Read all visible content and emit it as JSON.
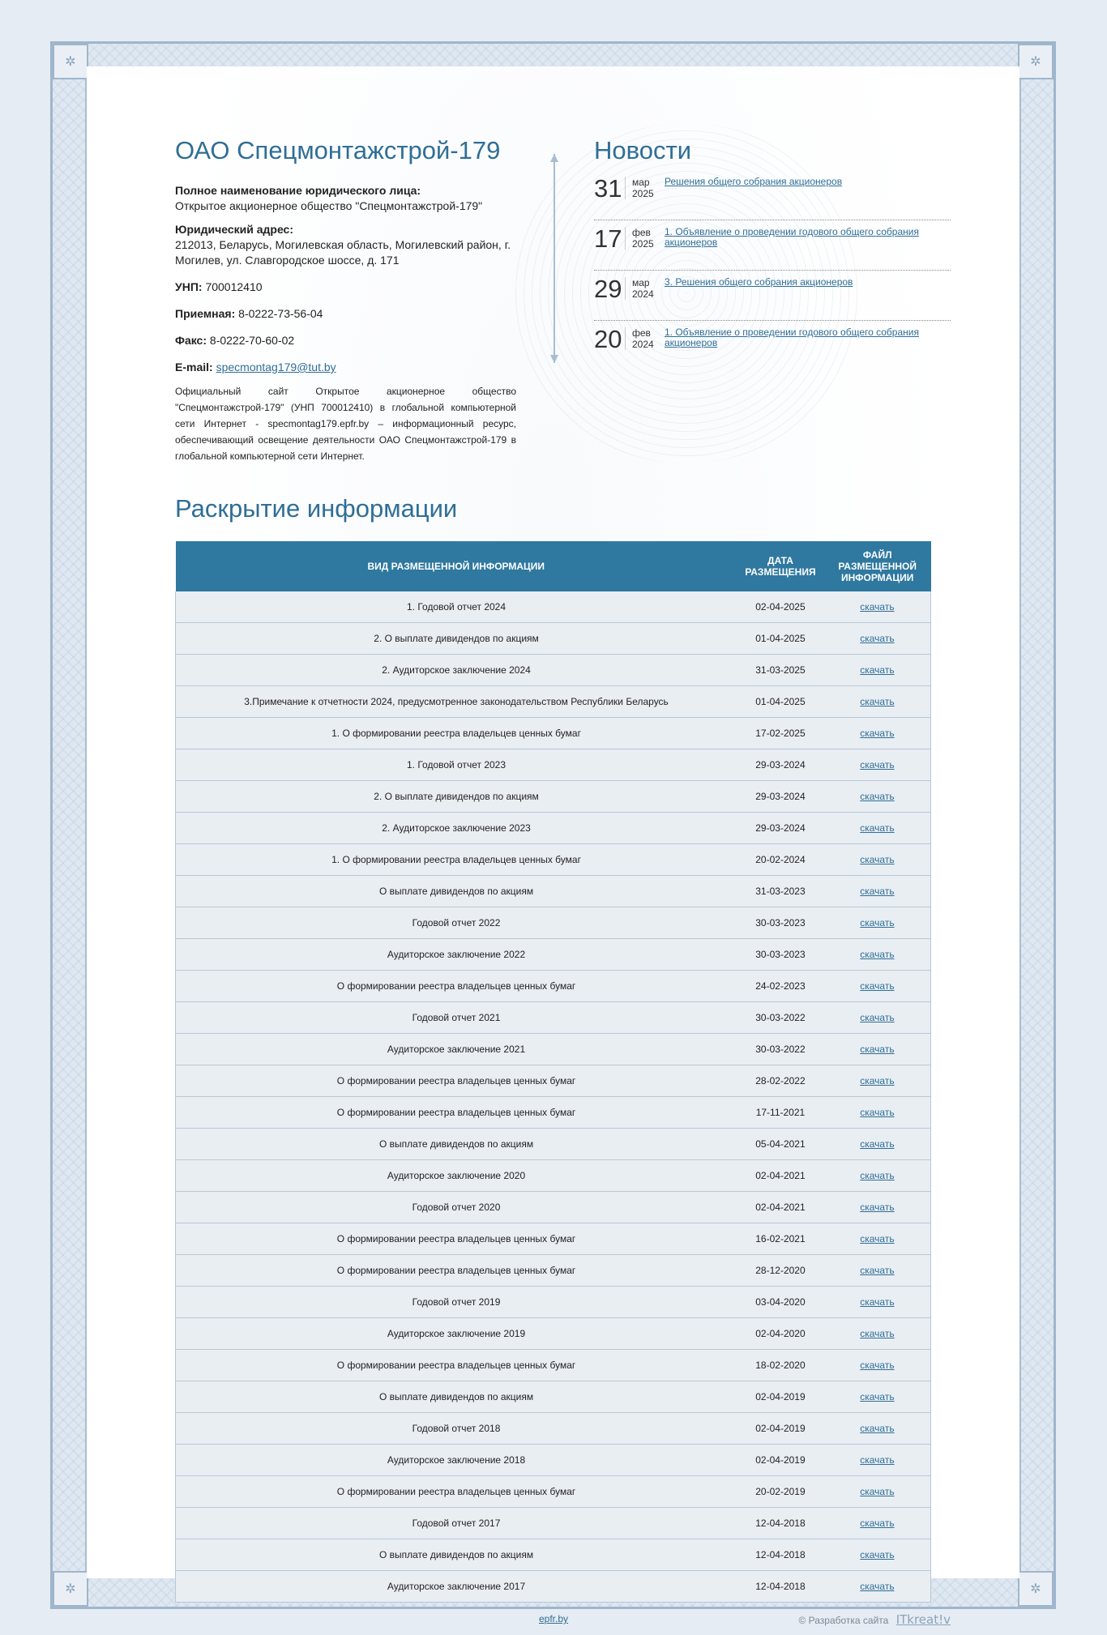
{
  "company": {
    "title": "ОАО Спецмонтажстрой-179",
    "full_name_label": "Полное наименование юридического лица:",
    "full_name": "Открытое акционерное общество \"Спецмонтажстрой-179\"",
    "address_label": "Юридический адрес:",
    "address": "212013, Беларусь, Могилевская область, Могилевский район, г. Могилев, ул. Славгородское шоссе, д. 171",
    "unp_label": "УНП:",
    "unp": "700012410",
    "reception_label": "Приемная:",
    "reception": "8-0222-73-56-04",
    "fax_label": "Факс:",
    "fax": "8-0222-70-60-02",
    "email_label": "E-mail:",
    "email": "specmontag179@tut.by",
    "about": "Официальный сайт Открытое акционерное общество \"Спецмонтажстрой-179\" (УНП 700012410) в глобальной компьютерной сети Интернет - specmontag179.epfr.by – информационный ресурс, обеспечивающий освещение деятельности ОАО Спецмонтажстрой-179 в глобальной компьютерной сети Интернет."
  },
  "news": {
    "title": "Новости",
    "items": [
      {
        "day": "31",
        "month": "мар",
        "year": "2025",
        "text": "Решения общего собрания акционеров"
      },
      {
        "day": "17",
        "month": "фев",
        "year": "2025",
        "text": "1. Объявление о проведении годового общего собрания акционеров"
      },
      {
        "day": "29",
        "month": "мар",
        "year": "2024",
        "text": "3. Решения общего собрания акционеров"
      },
      {
        "day": "20",
        "month": "фев",
        "year": "2024",
        "text": "1. Объявление о проведении годового общего собрания акционеров"
      }
    ]
  },
  "disclosure": {
    "title": "Раскрытие информации",
    "headers": [
      "Вид размещенной информации",
      "Дата размещения",
      "Файл размещенной информации"
    ],
    "download_label": "скачать",
    "rows": [
      [
        "1. Годовой отчет 2024",
        "02-04-2025"
      ],
      [
        "2. О выплате дивидендов по акциям",
        "01-04-2025"
      ],
      [
        "2. Аудиторское заключение 2024",
        "31-03-2025"
      ],
      [
        "3.Примечание к отчетности 2024, предусмотренное законодательством Республики Беларусь",
        "01-04-2025"
      ],
      [
        "1. О формировании реестра владельцев ценных бумаг",
        "17-02-2025"
      ],
      [
        "1. Годовой отчет 2023",
        "29-03-2024"
      ],
      [
        "2. О выплате дивидендов по акциям",
        "29-03-2024"
      ],
      [
        "2. Аудиторское заключение 2023",
        "29-03-2024"
      ],
      [
        "1. О формировании реестра владельцев ценных бумаг",
        "20-02-2024"
      ],
      [
        "О выплате дивидендов по акциям",
        "31-03-2023"
      ],
      [
        "Годовой отчет 2022",
        "30-03-2023"
      ],
      [
        "Аудиторское заключение 2022",
        "30-03-2023"
      ],
      [
        "О формировании реестра владельцев ценных бумаг",
        "24-02-2023"
      ],
      [
        "Годовой отчет 2021",
        "30-03-2022"
      ],
      [
        "Аудиторское заключение 2021",
        "30-03-2022"
      ],
      [
        "О формировании реестра владельцев ценных бумаг",
        "28-02-2022"
      ],
      [
        "О формировании реестра владельцев ценных бумаг",
        "17-11-2021"
      ],
      [
        "О выплате дивидендов по акциям",
        "05-04-2021"
      ],
      [
        "Аудиторское заключение 2020",
        "02-04-2021"
      ],
      [
        "Годовой отчет 2020",
        "02-04-2021"
      ],
      [
        "О формировании реестра владельцев ценных бумаг",
        "16-02-2021"
      ],
      [
        "О формировании реестра владельцев ценных бумаг",
        "28-12-2020"
      ],
      [
        "Годовой отчет 2019",
        "03-04-2020"
      ],
      [
        "Аудиторское заключение 2019",
        "02-04-2020"
      ],
      [
        "О формировании реестра владельцев ценных бумаг",
        "18-02-2020"
      ],
      [
        "О выплате дивидендов по акциям",
        "02-04-2019"
      ],
      [
        "Годовой отчет 2018",
        "02-04-2019"
      ],
      [
        "Аудиторское заключение 2018",
        "02-04-2019"
      ],
      [
        "О формировании реестра владельцев ценных бумаг",
        "20-02-2019"
      ],
      [
        "Годовой отчет 2017",
        "12-04-2018"
      ],
      [
        "О выплате дивидендов по акциям",
        "12-04-2018"
      ],
      [
        "Аудиторское заключение 2017",
        "12-04-2018"
      ]
    ]
  },
  "footer": {
    "site_link": "epfr.by",
    "dev_text": "© Разработка сайта",
    "dev_brand": "ITkreat!v"
  },
  "colors": {
    "accent": "#2f6e96",
    "header_bg": "#2f78a0",
    "row_bg": "#e9eef3",
    "page_bg": "#e6ecf3"
  }
}
